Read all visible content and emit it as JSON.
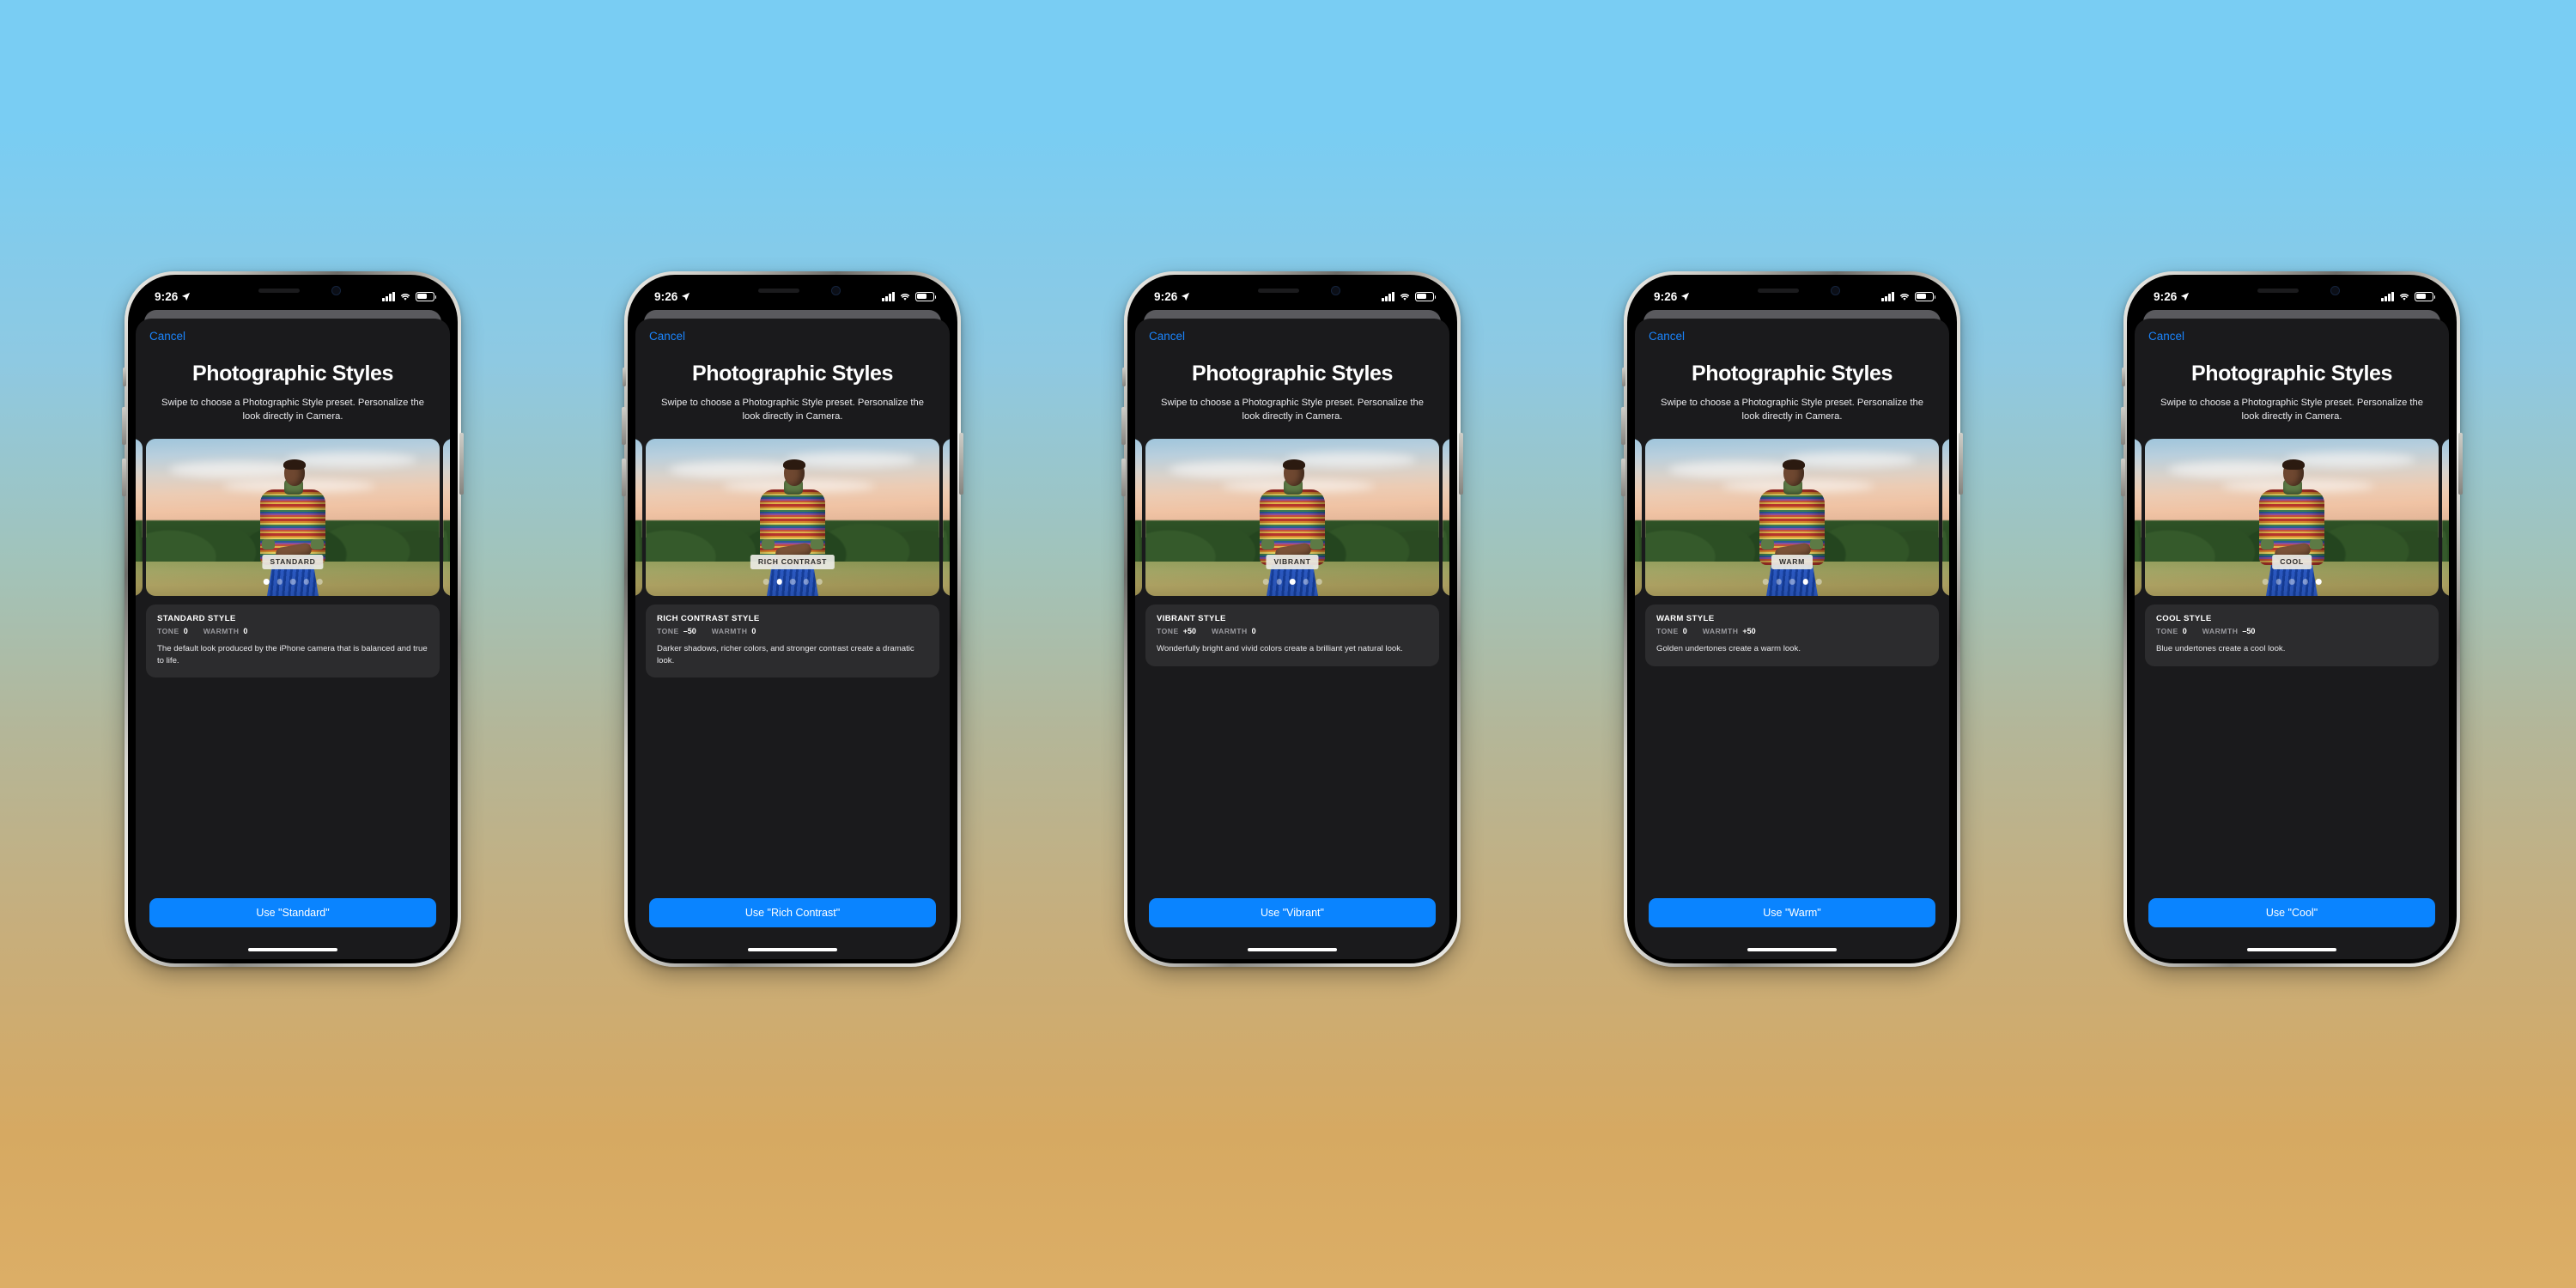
{
  "background": {
    "top_color": "#79cdf3",
    "bottom_color": "#dcae66"
  },
  "accent_color": "#0a84ff",
  "status_bar": {
    "time": "9:26",
    "location_icon": "location-arrow-icon",
    "cellular_icon": "cellular-bars-icon",
    "wifi_icon": "wifi-icon",
    "battery_icon": "battery-icon"
  },
  "sheet": {
    "cancel_label": "Cancel",
    "title": "Photographic Styles",
    "subtitle": "Swipe to choose a Photographic Style preset. Personalize the look directly in Camera."
  },
  "labels": {
    "tone": "TONE",
    "warmth": "WARMTH"
  },
  "phones": [
    {
      "badge": "STANDARD",
      "active_dot": 0,
      "style_name": "STANDARD STYLE",
      "tone": "0",
      "warmth": "0",
      "description": "The default look produced by the iPhone camera that is balanced and true to life.",
      "cta_label": "Use \"Standard\""
    },
    {
      "badge": "RICH CONTRAST",
      "active_dot": 1,
      "style_name": "RICH CONTRAST STYLE",
      "tone": "–50",
      "warmth": "0",
      "description": "Darker shadows, richer colors, and stronger contrast create a dramatic look.",
      "cta_label": "Use \"Rich Contrast\""
    },
    {
      "badge": "VIBRANT",
      "active_dot": 2,
      "style_name": "VIBRANT STYLE",
      "tone": "+50",
      "warmth": "0",
      "description": "Wonderfully bright and vivid colors create a brilliant yet natural look.",
      "cta_label": "Use \"Vibrant\""
    },
    {
      "badge": "WARM",
      "active_dot": 3,
      "style_name": "WARM STYLE",
      "tone": "0",
      "warmth": "+50",
      "description": "Golden undertones create a warm look.",
      "cta_label": "Use \"Warm\""
    },
    {
      "badge": "COOL",
      "active_dot": 4,
      "style_name": "COOL STYLE",
      "tone": "0",
      "warmth": "–50",
      "description": "Blue undertones create a cool look.",
      "cta_label": "Use \"Cool\""
    }
  ]
}
